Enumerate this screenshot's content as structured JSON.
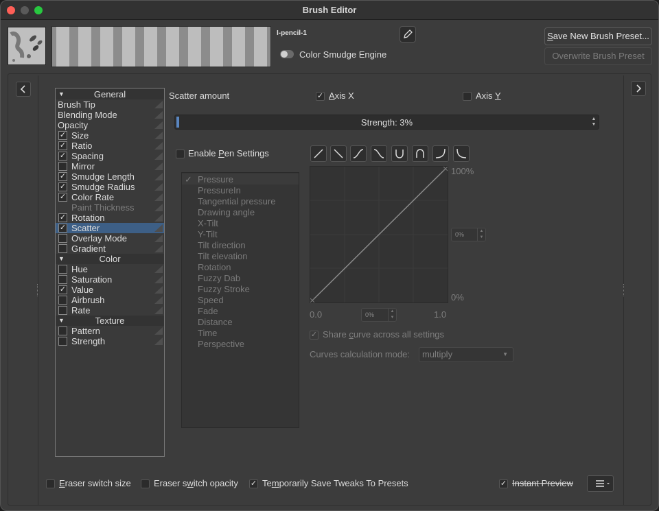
{
  "window": {
    "title": "Brush Editor"
  },
  "preset": {
    "name": "I-pencil-1",
    "engine_label": "Color Smudge Engine",
    "save_new_label": "Save New Brush Preset...",
    "overwrite_label": "Overwrite Brush Preset"
  },
  "options": [
    {
      "type": "header",
      "label": "General"
    },
    {
      "type": "flat",
      "label": "Brush Tip"
    },
    {
      "type": "flat",
      "label": "Blending Mode"
    },
    {
      "type": "flat",
      "label": "Opacity"
    },
    {
      "type": "check",
      "label": "Size",
      "checked": true
    },
    {
      "type": "check",
      "label": "Ratio",
      "checked": true
    },
    {
      "type": "check",
      "label": "Spacing",
      "checked": true
    },
    {
      "type": "check",
      "label": "Mirror",
      "checked": false
    },
    {
      "type": "check",
      "label": "Smudge Length",
      "checked": true
    },
    {
      "type": "check",
      "label": "Smudge Radius",
      "checked": true
    },
    {
      "type": "check",
      "label": "Color Rate",
      "checked": true
    },
    {
      "type": "disabled",
      "label": "Paint Thickness"
    },
    {
      "type": "check",
      "label": "Rotation",
      "checked": true
    },
    {
      "type": "check",
      "label": "Scatter",
      "checked": true,
      "selected": true
    },
    {
      "type": "check",
      "label": "Overlay Mode",
      "checked": false
    },
    {
      "type": "check",
      "label": "Gradient",
      "checked": false
    },
    {
      "type": "header",
      "label": "Color"
    },
    {
      "type": "check",
      "label": "Hue",
      "checked": false
    },
    {
      "type": "check",
      "label": "Saturation",
      "checked": false
    },
    {
      "type": "check",
      "label": "Value",
      "checked": true
    },
    {
      "type": "check",
      "label": "Airbrush",
      "checked": false
    },
    {
      "type": "check",
      "label": "Rate",
      "checked": false
    },
    {
      "type": "header",
      "label": "Texture"
    },
    {
      "type": "check",
      "label": "Pattern",
      "checked": false
    },
    {
      "type": "check",
      "label": "Strength",
      "checked": false
    }
  ],
  "scatter": {
    "amount_label": "Scatter amount",
    "axis_x": {
      "pre": "",
      "mnemonic": "A",
      "post": "xis X",
      "checked": true
    },
    "axis_y": {
      "pre": "Axis ",
      "mnemonic": "Y",
      "post": "",
      "checked": false
    },
    "strength_text": "Strength: 3%",
    "strength_value": 0.03,
    "enable_pen": {
      "pre": "Enable ",
      "mnemonic": "P",
      "post": "en Settings",
      "checked": false
    }
  },
  "sensors": [
    "Pressure",
    "PressureIn",
    "Tangential pressure",
    "Drawing angle",
    "X-Tilt",
    "Y-Tilt",
    "Tilt direction",
    "Tilt elevation",
    "Rotation",
    "Fuzzy Dab",
    "Fuzzy Stroke",
    "Speed",
    "Fade",
    "Distance",
    "Time",
    "Perspective"
  ],
  "curve": {
    "y_max": "100%",
    "y_min": "0%",
    "x_min": "0.0",
    "x_max": "1.0",
    "y_spin": "0%",
    "x_spin": "0%",
    "share_pre": "Share ",
    "share_mnemonic": "c",
    "share_post": "urve across all settings",
    "share_checked": true,
    "calc_label": "Curves calculation mode:",
    "calc_value": "multiply"
  },
  "footer": {
    "eraser_size": {
      "pre": "",
      "mnemonic": "E",
      "post": "raser switch size",
      "checked": false
    },
    "eraser_opacity": {
      "pre": "Eraser s",
      "mnemonic": "w",
      "post": "itch opacity",
      "checked": false
    },
    "temp_save": {
      "pre": "Te",
      "mnemonic": "m",
      "post": "porarily Save Tweaks To Presets",
      "checked": true
    },
    "instant_preview": {
      "label": "Instant Preview",
      "checked": true
    }
  },
  "colors": {
    "accent": "#3d5f86",
    "slider_fill": "#5a86c0"
  }
}
